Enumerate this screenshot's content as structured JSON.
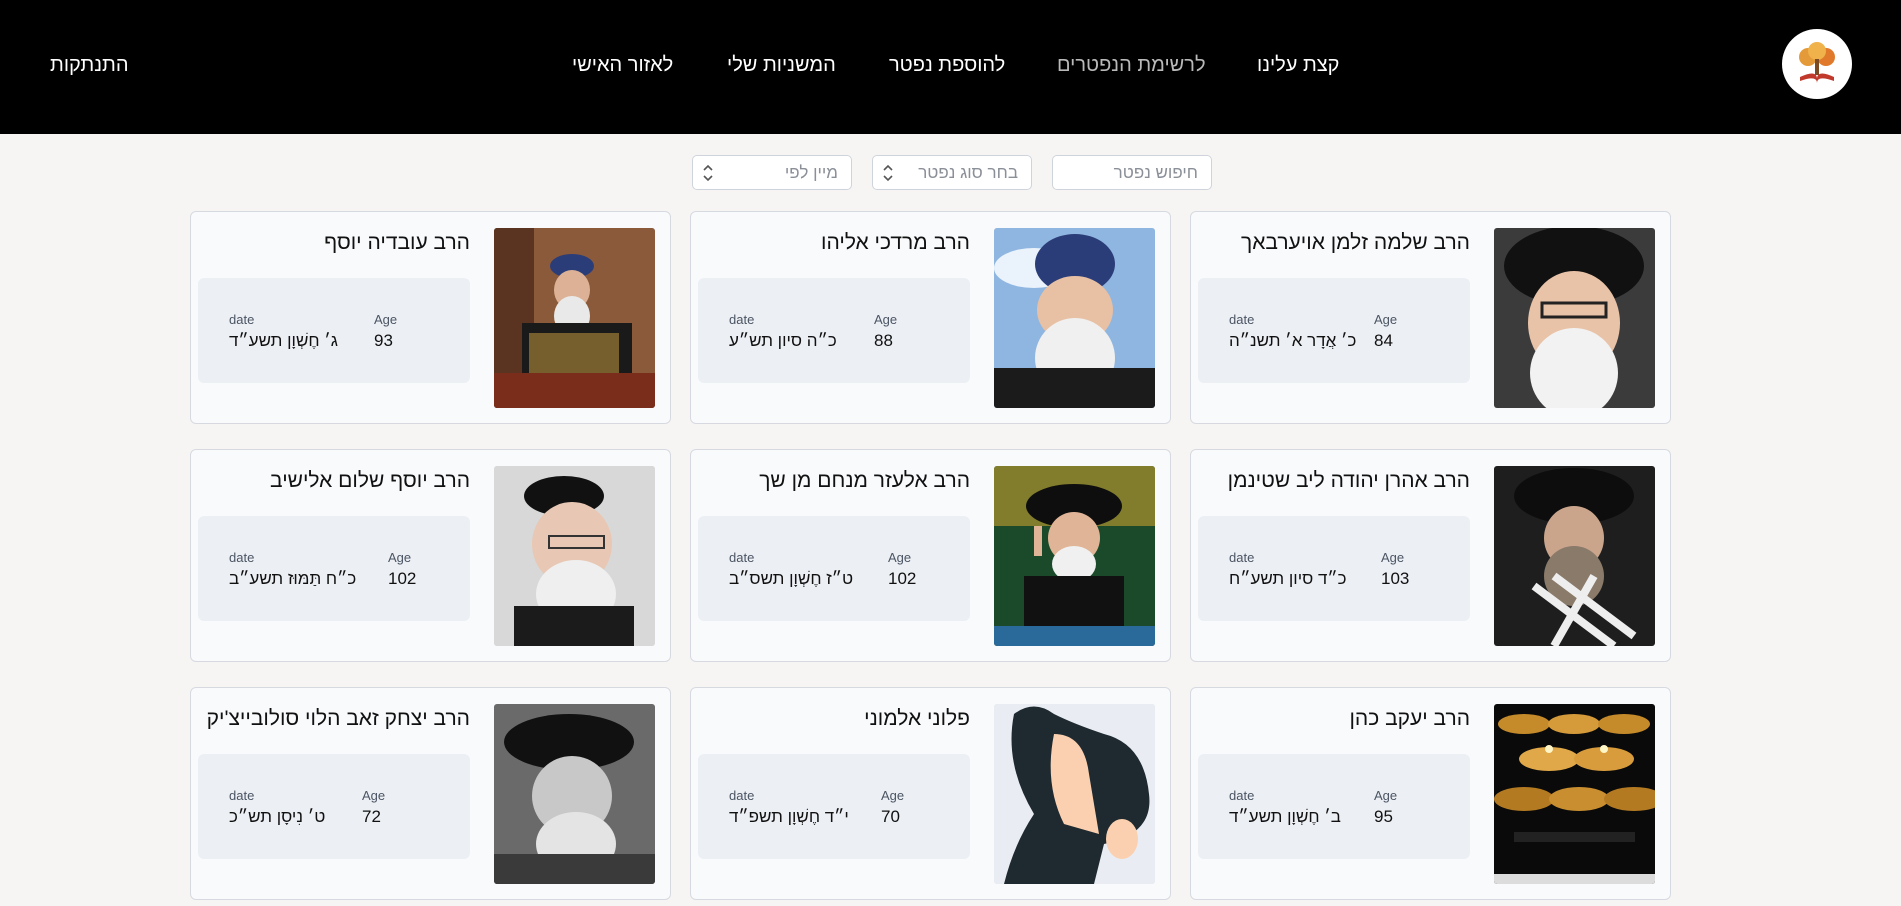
{
  "nav": {
    "about": "קצת עלינו",
    "deceased_list": "לרשימת הנפטרים",
    "add_deceased": "להוספת נפטר",
    "my_mishnayot": "המשניות שלי",
    "personal_area": "לאזור האישי",
    "logout": "התנתקות"
  },
  "filters": {
    "search_placeholder": "חיפוש נפטר",
    "type_select": "בחר סוג נפטר",
    "sort_select": "מיין לפי"
  },
  "labels": {
    "age": "Age",
    "date": "date"
  },
  "cards": [
    {
      "name": "הרב שלמה זלמן אויערבאך",
      "age": "84",
      "date": "כ׳ אֲדָר א׳ תשנ״ה",
      "photo": "portrait-black-hat-smiling"
    },
    {
      "name": "הרב מרדכי אליהו",
      "age": "88",
      "date": "כ״ה סיון תש״ע",
      "photo": "portrait-blue-turban"
    },
    {
      "name": "הרב עובדיה יוסף",
      "age": "93",
      "date": "ג׳ חֶשְׁוָן תשע״ד",
      "photo": "portrait-reading-gold-robe"
    },
    {
      "name": "הרב אהרן יהודה ליב שטינמן",
      "age": "103",
      "date": "כ״ד סיון תשע״ח",
      "photo": "portrait-tallit"
    },
    {
      "name": "הרב אלעזר מנחם מן שך",
      "age": "102",
      "date": "ט״ז חֶשְׁוָן תשס״ב",
      "photo": "portrait-speaking"
    },
    {
      "name": "הרב יוסף שלום אלישיב",
      "age": "102",
      "date": "כ״ח תַּמּוּז תשע״ב",
      "photo": "portrait-kippah-glasses"
    },
    {
      "name": "הרב יעקב כהן",
      "age": "95",
      "date": "ב׳ חֶשְׁוָן תשע״ד",
      "photo": "memorial-candles"
    },
    {
      "name": "פלוני אלמוני",
      "age": "70",
      "date": "י״ד חֶשְׁוָן תשפ״ד",
      "photo": "placeholder-avatar"
    },
    {
      "name": "הרב יצחק זאב הלוי סולובייצ'יק",
      "age": "72",
      "date": "ט׳ נִיסָן תש״כ",
      "photo": "portrait-grayscale-hat"
    }
  ]
}
